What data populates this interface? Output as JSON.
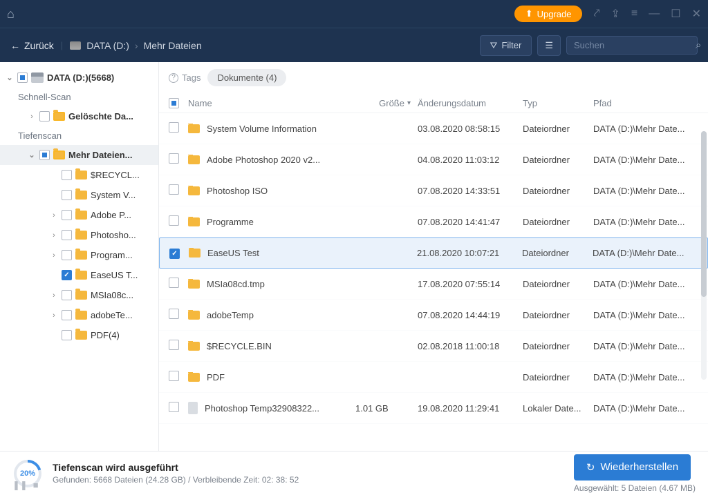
{
  "titlebar": {
    "upgrade": "Upgrade"
  },
  "nav": {
    "back": "Zurück",
    "breadcrumb_drive": "DATA (D:)",
    "breadcrumb_folder": "Mehr Dateien",
    "filter": "Filter",
    "search_placeholder": "Suchen"
  },
  "tree": {
    "root": "DATA (D:)(5668)",
    "quickscan": "Schnell-Scan",
    "deleted": "Gelöschte Da...",
    "deepscan": "Tiefenscan",
    "more_files": "Mehr Dateien...",
    "items": [
      {
        "label": "$RECYCL..."
      },
      {
        "label": "System V..."
      },
      {
        "label": "Adobe P..."
      },
      {
        "label": "Photosho..."
      },
      {
        "label": "Program..."
      },
      {
        "label": "EaseUS T..."
      },
      {
        "label": "MSIa08c..."
      },
      {
        "label": "adobeTe..."
      },
      {
        "label": "PDF(4)"
      }
    ]
  },
  "tags": {
    "label": "Tags",
    "doc": "Dokumente (4)"
  },
  "columns": {
    "name": "Name",
    "size": "Größe",
    "date": "Änderungsdatum",
    "type": "Typ",
    "path": "Pfad"
  },
  "rows": [
    {
      "name": "System Volume Information",
      "size": "",
      "date": "03.08.2020 08:58:15",
      "type": "Dateiordner",
      "path": "DATA (D:)\\Mehr Date...",
      "kind": "folder",
      "checked": false
    },
    {
      "name": "Adobe Photoshop 2020 v2...",
      "size": "",
      "date": "04.08.2020 11:03:12",
      "type": "Dateiordner",
      "path": "DATA (D:)\\Mehr Date...",
      "kind": "folder",
      "checked": false
    },
    {
      "name": "Photoshop ISO",
      "size": "",
      "date": "07.08.2020 14:33:51",
      "type": "Dateiordner",
      "path": "DATA (D:)\\Mehr Date...",
      "kind": "folder",
      "checked": false
    },
    {
      "name": "Programme",
      "size": "",
      "date": "07.08.2020 14:41:47",
      "type": "Dateiordner",
      "path": "DATA (D:)\\Mehr Date...",
      "kind": "folder",
      "checked": false
    },
    {
      "name": "EaseUS Test",
      "size": "",
      "date": "21.08.2020 10:07:21",
      "type": "Dateiordner",
      "path": "DATA (D:)\\Mehr Date...",
      "kind": "folder",
      "checked": true
    },
    {
      "name": "MSIa08cd.tmp",
      "size": "",
      "date": "17.08.2020 07:55:14",
      "type": "Dateiordner",
      "path": "DATA (D:)\\Mehr Date...",
      "kind": "folder",
      "checked": false
    },
    {
      "name": "adobeTemp",
      "size": "",
      "date": "07.08.2020 14:44:19",
      "type": "Dateiordner",
      "path": "DATA (D:)\\Mehr Date...",
      "kind": "folder",
      "checked": false
    },
    {
      "name": "$RECYCLE.BIN",
      "size": "",
      "date": "02.08.2018 11:00:18",
      "type": "Dateiordner",
      "path": "DATA (D:)\\Mehr Date...",
      "kind": "folder",
      "checked": false
    },
    {
      "name": "PDF",
      "size": "",
      "date": "",
      "type": "Dateiordner",
      "path": "DATA (D:)\\Mehr Date...",
      "kind": "folder",
      "checked": false
    },
    {
      "name": "Photoshop Temp32908322...",
      "size": "1.01 GB",
      "date": "19.08.2020 11:29:41",
      "type": "Lokaler Date...",
      "path": "DATA (D:)\\Mehr Date...",
      "kind": "file",
      "checked": false
    }
  ],
  "status": {
    "percent": "20%",
    "title": "Tiefenscan wird ausgeführt",
    "sub": "Gefunden: 5668 Dateien (24.28 GB) / Verbleibende Zeit: 02: 38: 52",
    "recover": "Wiederherstellen",
    "selected": "Ausgewählt: 5 Dateien (4.67 MB)"
  }
}
